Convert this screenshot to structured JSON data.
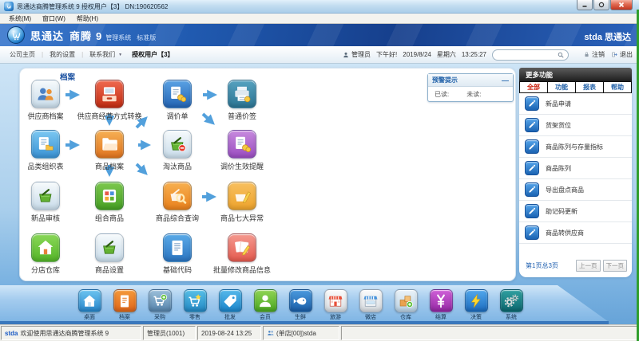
{
  "window": {
    "title": "思通达商腾管理系统 9 授权用户【3】 DN:190620562",
    "menu": [
      {
        "label": "系统(M)"
      },
      {
        "label": "窗口(W)"
      },
      {
        "label": "帮助(H)"
      }
    ]
  },
  "banner": {
    "name1": "思通达",
    "name2": "商腾",
    "version": "9",
    "suffix": "管理系统",
    "edition": "标准版",
    "right_brand": "stda 思通达"
  },
  "navbar": {
    "links": [
      {
        "label": "公司主页"
      },
      {
        "label": "我的设置"
      },
      {
        "label": "联系我们",
        "dropdown": true
      }
    ],
    "separator": "|",
    "caret": "▼",
    "active_tab": "授权用户【3】",
    "user": "管理员",
    "greeting": "下午好!",
    "date": "2019/8/24",
    "weekday": "星期六",
    "time": "13:25:27",
    "logout": "注销",
    "exit": "退出"
  },
  "main": {
    "group_label": "档案",
    "icons": [
      {
        "label": "供应商档案",
        "glyph": "people",
        "c1": "#f6fafc",
        "c2": "#c9dcea"
      },
      {
        "label": "供应商经营方式转换",
        "glyph": "screen",
        "c1": "#ef6a50",
        "c2": "#c22c12"
      },
      {
        "label": "调价单",
        "glyph": "doc-coins",
        "c1": "#5aa2e4",
        "c2": "#2464b4"
      },
      {
        "label": "普通价签",
        "glyph": "printer",
        "c1": "#56a2c0",
        "c2": "#2c7492"
      },
      {
        "label": "品类组织表",
        "glyph": "sheet-folder",
        "c1": "#7cc8f2",
        "c2": "#3a92d4"
      },
      {
        "label": "商品档案",
        "glyph": "folder",
        "c1": "#f6b055",
        "c2": "#e0741e"
      },
      {
        "label": "淘汰商品",
        "glyph": "basket-minus",
        "c1": "#f6fafc",
        "c2": "#c9dcea"
      },
      {
        "label": "调价生效提醒",
        "glyph": "doc-coins",
        "c1": "#c78ade",
        "c2": "#9a4cc0"
      },
      {
        "label": "新品审核",
        "glyph": "basket",
        "c1": "#f6fafc",
        "c2": "#c9dcea"
      },
      {
        "label": "组合商品",
        "glyph": "grid",
        "c1": "#7cc84e",
        "c2": "#46a024"
      },
      {
        "label": "商品综合查询",
        "glyph": "basket-search",
        "c1": "#f8b050",
        "c2": "#e8801c"
      },
      {
        "label": "商品七大异常",
        "glyph": "basket-pencil",
        "c1": "#f8c060",
        "c2": "#eda32c"
      },
      {
        "label": "分店仓库",
        "glyph": "house",
        "c1": "#8ad858",
        "c2": "#54b428"
      },
      {
        "label": "商品设置",
        "glyph": "basket",
        "c1": "#f6fafc",
        "c2": "#c9dcea"
      },
      {
        "label": "基础代码",
        "glyph": "doc",
        "c1": "#5aaae8",
        "c2": "#2a74c0"
      },
      {
        "label": "批量修改商品信息",
        "glyph": "docs-pencil",
        "c1": "#f59a90",
        "c2": "#e45a4e"
      }
    ]
  },
  "alert_box": {
    "title": "预警提示",
    "minimize": "—",
    "read": "已读:",
    "unread": "未读:"
  },
  "sidebar": {
    "header": "更多功能",
    "tabs": [
      {
        "label": "全部",
        "active": true
      },
      {
        "label": "功能"
      },
      {
        "label": "报表"
      },
      {
        "label": "帮助"
      }
    ],
    "items": [
      {
        "label": "新品申请"
      },
      {
        "label": "货架货位"
      },
      {
        "label": "商品陈列与存量指标"
      },
      {
        "label": "商品陈列"
      },
      {
        "label": "导出盘点商品"
      },
      {
        "label": "助记码更新"
      },
      {
        "label": "商品转供应商"
      }
    ],
    "pagination": {
      "info": "第1页总3页",
      "prev": "上一页",
      "next": "下一页"
    }
  },
  "dock": {
    "items": [
      {
        "label": "桌面",
        "glyph": "house-w",
        "c1": "#6cc4f0",
        "c2": "#2686cc"
      },
      {
        "label": "档案",
        "glyph": "doc-w",
        "c1": "#f49a3c",
        "c2": "#e0661a"
      },
      {
        "label": "采购",
        "glyph": "cart-plus",
        "c1": "#9cc0da",
        "c2": "#5684ac"
      },
      {
        "label": "零售",
        "glyph": "cart-star",
        "c1": "#58c0e8",
        "c2": "#2288c4"
      },
      {
        "label": "批发",
        "glyph": "tag",
        "c1": "#55b8ea",
        "c2": "#1c86cc"
      },
      {
        "label": "会员",
        "glyph": "person-w",
        "c1": "#90d455",
        "c2": "#4aa822"
      },
      {
        "label": "生鲜",
        "glyph": "fish",
        "c1": "#4a9ade",
        "c2": "#1a5ea8"
      },
      {
        "label": "旅游",
        "glyph": "store-red",
        "c1": "#fbfbfb",
        "c2": "#d8dde2"
      },
      {
        "label": "微店",
        "glyph": "store-awning",
        "c1": "#fbfbfb",
        "c2": "#d8dde2"
      },
      {
        "label": "仓库",
        "glyph": "boxes-plus",
        "c1": "#eaf2f8",
        "c2": "#bcd4e6"
      },
      {
        "label": "结算",
        "glyph": "yen",
        "c1": "#d060d8",
        "c2": "#9428a4"
      },
      {
        "label": "决策",
        "glyph": "bolt",
        "c1": "#52a8ec",
        "c2": "#1c6cc0"
      },
      {
        "label": "系统",
        "glyph": "gears",
        "c1": "#30a0a0",
        "c2": "#0c6870"
      }
    ]
  },
  "statusbar": {
    "brand": "stda",
    "welcome": "欢迎使用思通达商腾管理系统 9",
    "user": "管理员(1001)",
    "datetime": "2019-08-24 13:25",
    "store": "(单店[00])stda"
  }
}
